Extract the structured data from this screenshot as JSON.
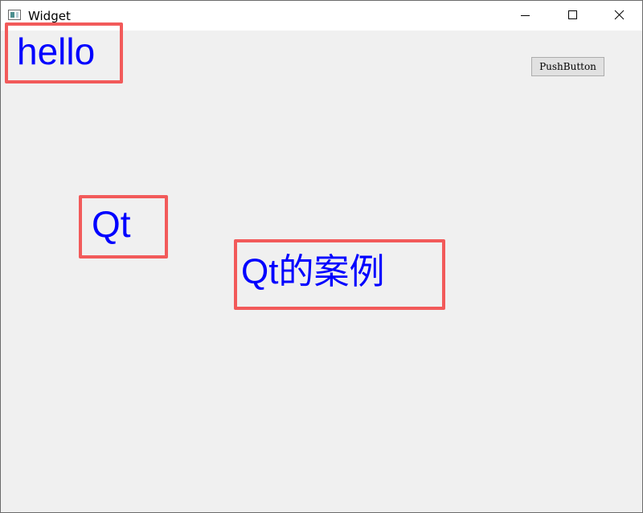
{
  "window": {
    "title": "Widget",
    "icon": "app-window-icon",
    "controls": {
      "minimize": "minimize-icon",
      "maximize": "maximize-icon",
      "close": "close-icon"
    }
  },
  "content": {
    "labels": {
      "hello": "hello",
      "qt": "Qt",
      "qt_case_latin": "Qt",
      "qt_case_cjk": "的案例"
    },
    "button": {
      "label": "PushButton"
    }
  },
  "colors": {
    "label_text": "#0000ff",
    "highlight_box": "#f25a5a",
    "window_background": "#f0f0f0"
  }
}
